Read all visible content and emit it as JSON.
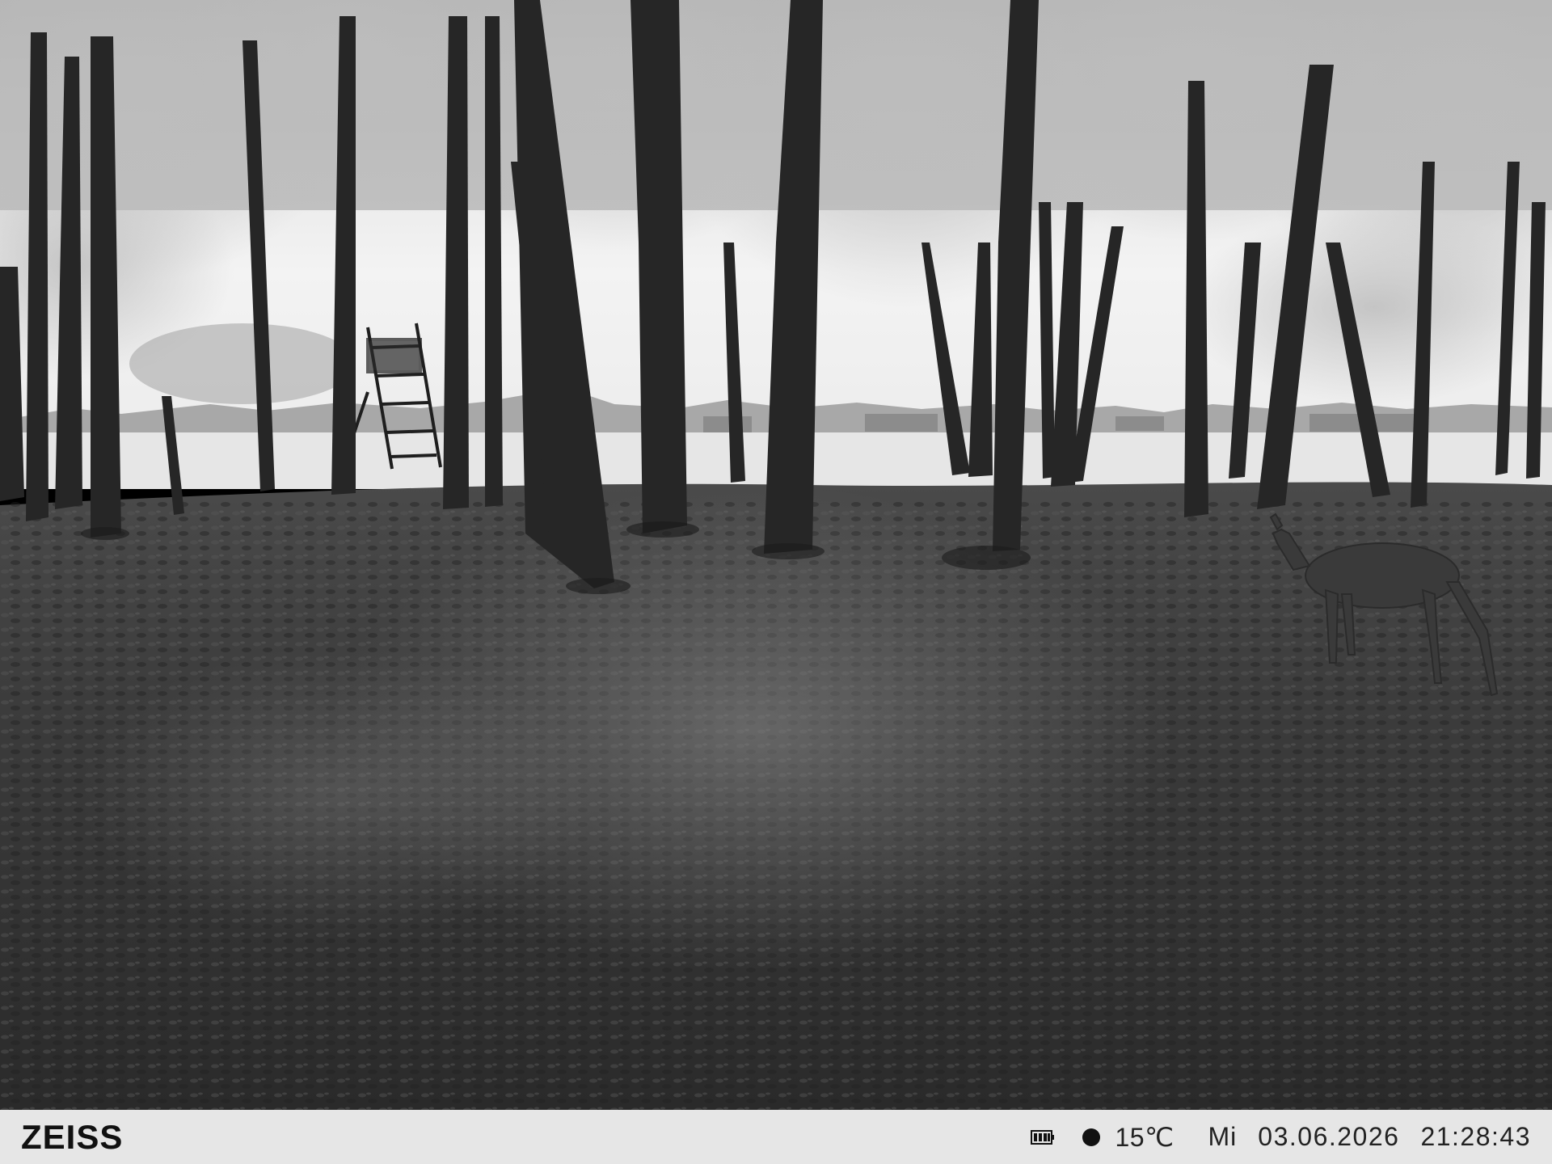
{
  "camera": {
    "brand": "ZEISS",
    "battery_icon": "battery-icon",
    "moon_phase_icon": "moon-icon",
    "temperature": "15℃",
    "weekday": "Mi",
    "date": "03.06.2026",
    "time": "21:28:43"
  },
  "colors": {
    "infobar_background": "#e6e6e6",
    "infobar_text": "#111111",
    "sky": "#f2f2f2",
    "field": "#e8e8e8",
    "forest_floor": "#3a3a3a",
    "tree_trunk": "#262626"
  },
  "scene": {
    "subject": "deer",
    "structure": "hunting-stand"
  }
}
